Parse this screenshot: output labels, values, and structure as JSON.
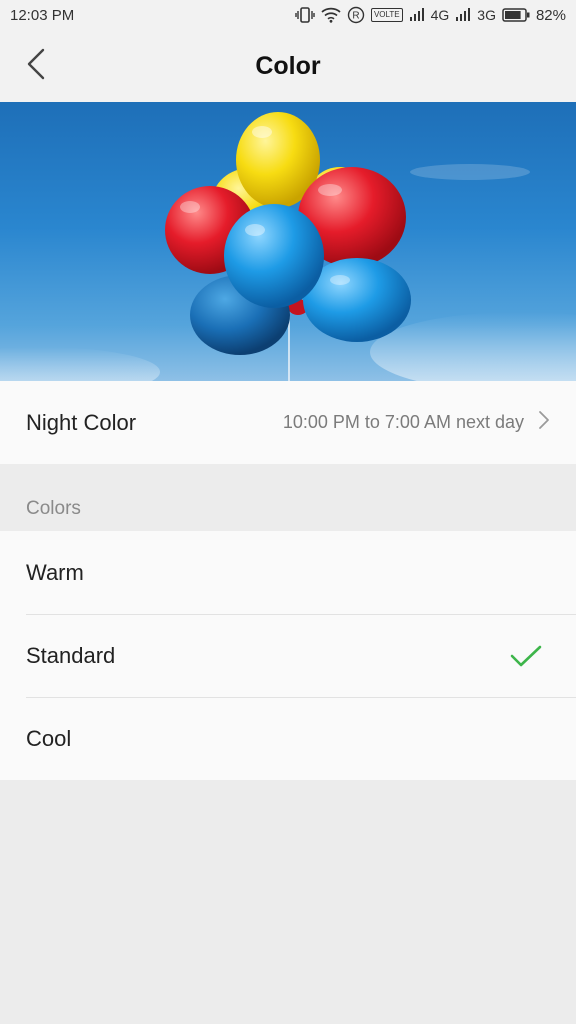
{
  "status_bar": {
    "time": "12:03 PM",
    "network_4g": "4G",
    "network_3g": "3G",
    "volte_label": "VOLTE",
    "battery_percent": "82%",
    "battery_level": 0.82
  },
  "header": {
    "title": "Color",
    "back_icon": "chevron-left-icon"
  },
  "night_color": {
    "label": "Night Color",
    "value": "10:00 PM to 7:00 AM next day",
    "icon": "chevron-right-icon"
  },
  "colors_section": {
    "header": "Colors",
    "options": [
      {
        "label": "Warm",
        "selected": false
      },
      {
        "label": "Standard",
        "selected": true
      },
      {
        "label": "Cool",
        "selected": false
      }
    ],
    "check_color": "#3db54a"
  }
}
